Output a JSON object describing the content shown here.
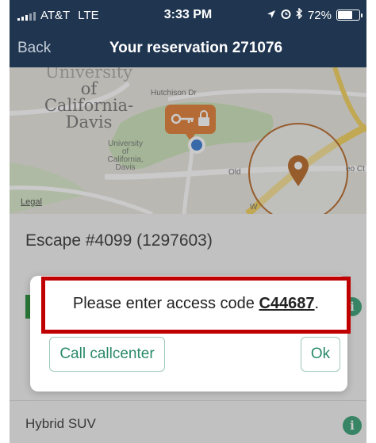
{
  "status_bar": {
    "carrier": "AT&T",
    "network": "LTE",
    "time": "3:33 PM",
    "battery": "72%",
    "battery_level": 0.72
  },
  "nav": {
    "back_label": "Back",
    "title": "Your reservation 271076"
  },
  "map": {
    "labels": {
      "university_big_1": "University",
      "university_big_2": "of",
      "university_big_3": "California-",
      "university_big_4": "Davis",
      "university_small_1": "University",
      "university_small_2": "of",
      "university_small_3": "California,",
      "university_small_4": "Davis",
      "street_hutchison": "Hutchison Dr",
      "street_old": "Old",
      "street_leo": "eo Ct",
      "street_w": "W"
    },
    "legal_label": "Legal",
    "colors": {
      "key_pin": "#e0772a",
      "location_dot": "#2f74d0",
      "destination_pin": "#b5621e",
      "road_yellow": "#f2cf55",
      "park_green": "#b9dba8"
    },
    "icons": {
      "key_pin": "key-lock-pin-icon",
      "location": "current-location-dot-icon",
      "destination": "map-pin-icon"
    }
  },
  "vehicle": {
    "name": "Escape #4099 (1297603)"
  },
  "dialog": {
    "message_prefix": "Please enter access code ",
    "access_code": "C44687",
    "message_suffix": ".",
    "call_button_label": "Call callcenter",
    "ok_button_label": "Ok"
  },
  "details": {
    "vehicle_type": "Hybrid SUV",
    "info_icon_glyph": "i"
  },
  "accent_colors": {
    "nav_background": "#1f3550",
    "highlight_border": "#c00000",
    "button_text": "#2a8a6a",
    "info_badge": "#2f9c6f",
    "status_green": "#1b8a2d"
  }
}
